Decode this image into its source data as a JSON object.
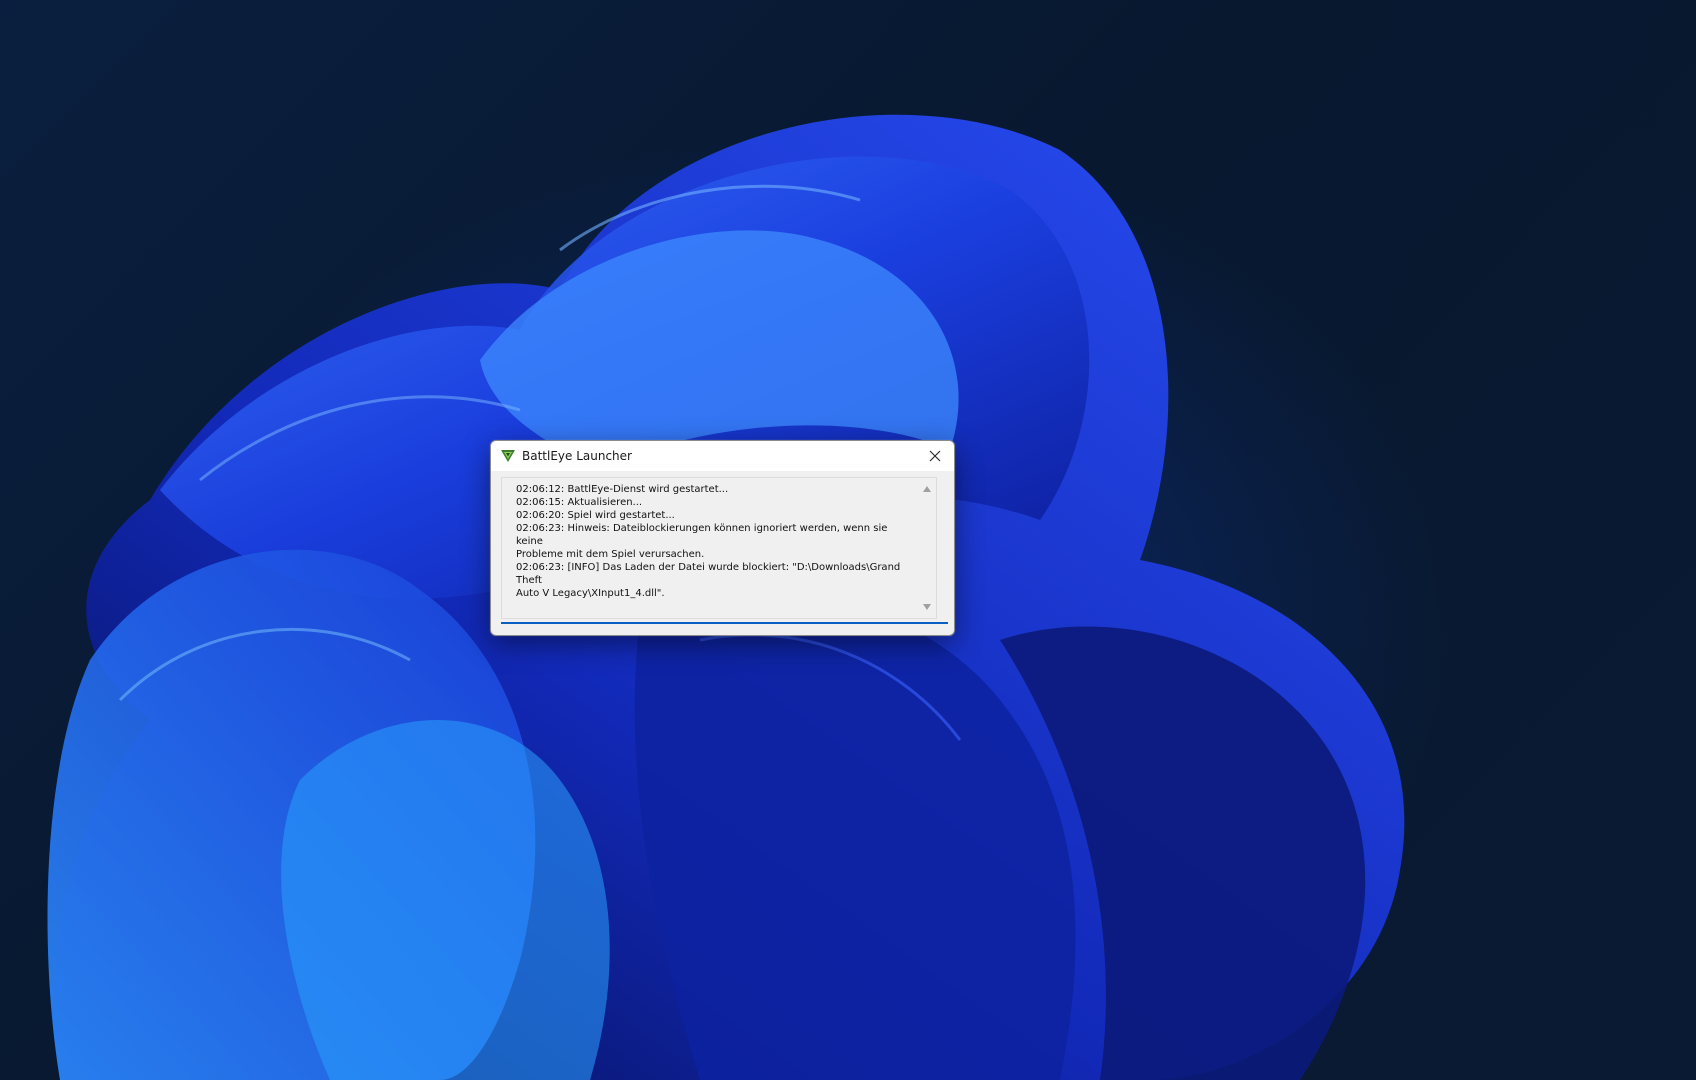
{
  "window": {
    "title": "BattlEye Launcher",
    "icon": "battleye-logo-icon",
    "close_icon": "close-icon"
  },
  "log": {
    "lines": [
      "02:06:12: BattlEye-Dienst wird gestartet...",
      "02:06:15: Aktualisieren...",
      "02:06:20: Spiel wird gestartet...",
      "02:06:23: Hinweis: Dateiblockierungen können ignoriert werden, wenn sie keine",
      "Probleme mit dem Spiel verursachen.",
      "02:06:23: [INFO] Das Laden der Datei wurde blockiert: \"D:\\Downloads\\Grand Theft",
      "Auto V Legacy\\XInput1_4.dll\"."
    ]
  },
  "progress": {
    "fraction": 1.0
  },
  "colors": {
    "accent": "#0a5fc4",
    "icon_green": "#3a7d2c"
  }
}
